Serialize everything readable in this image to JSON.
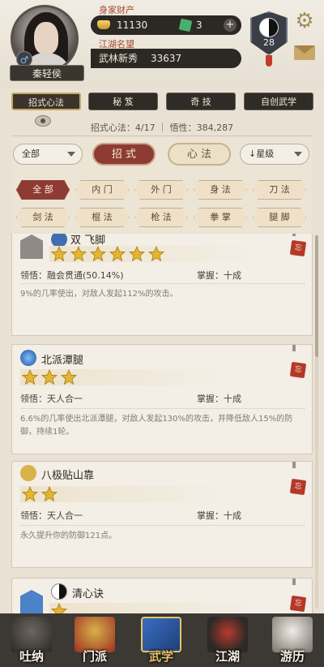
{
  "header": {
    "player_name": "秦轻侯",
    "gender_symbol": "♂",
    "assets_label": "身家财产",
    "gold": "11130",
    "jade": "3",
    "plus": "+",
    "reputation_label": "江湖名望",
    "reputation_title": "武林新秀",
    "reputation_value": "33637",
    "level": "28"
  },
  "tabs": [
    {
      "label": "招式心法",
      "active": true
    },
    {
      "label": "秘 笈",
      "active": false
    },
    {
      "label": "奇 技",
      "active": false
    },
    {
      "label": "自创武学",
      "active": false
    }
  ],
  "stats": {
    "text": "招式心法：4/17  ｜ 悟性：384,287"
  },
  "filters": {
    "scope_select": "全部",
    "type_active": "招 式",
    "type_other": "心 法",
    "sort_select": "↓星级",
    "chips": [
      {
        "label": "全 部",
        "active": true
      },
      {
        "label": "内 门",
        "active": false
      },
      {
        "label": "外 门",
        "active": false
      },
      {
        "label": "身 法",
        "active": false
      },
      {
        "label": "刀 法",
        "active": false
      },
      {
        "label": "剑 法",
        "active": false
      },
      {
        "label": "棍 法",
        "active": false
      },
      {
        "label": "枪 法",
        "active": false
      },
      {
        "label": "拳 掌",
        "active": false
      },
      {
        "label": "腿 脚",
        "active": false
      }
    ]
  },
  "skills": [
    {
      "name": "双 飞脚",
      "stars": 6,
      "comprehension": "领悟：融会贯通(50.14%)",
      "mastery": "掌握：十成",
      "description": "9%的几率使出，对敌人发起112%的攻击。",
      "seal": "忘"
    },
    {
      "name": "北派潭腿",
      "stars": 3,
      "comprehension": "领悟：天人合一",
      "mastery": "掌握：十成",
      "description": "6.6%的几率使出北派潭腿，对敌人发起130%的攻击，并降低敌人15%的防御，持续1轮。",
      "seal": "忘"
    },
    {
      "name": "八极贴山靠",
      "stars": 2,
      "comprehension": "领悟：天人合一",
      "mastery": "掌握：十成",
      "description": "永久提升你的防御121点。",
      "seal": "忘"
    },
    {
      "name": "清心诀",
      "stars": 1,
      "comprehension": "",
      "mastery": "",
      "description": "",
      "seal": "忘"
    }
  ],
  "nav": [
    {
      "label": "吐纳",
      "active": false
    },
    {
      "label": "门派",
      "active": false
    },
    {
      "label": "武学",
      "active": true
    },
    {
      "label": "江湖",
      "active": false
    },
    {
      "label": "游历",
      "active": false
    }
  ],
  "colors": {
    "accent_red": "#8e3c33",
    "gold": "#c9a764",
    "star": "#e5b52f"
  }
}
